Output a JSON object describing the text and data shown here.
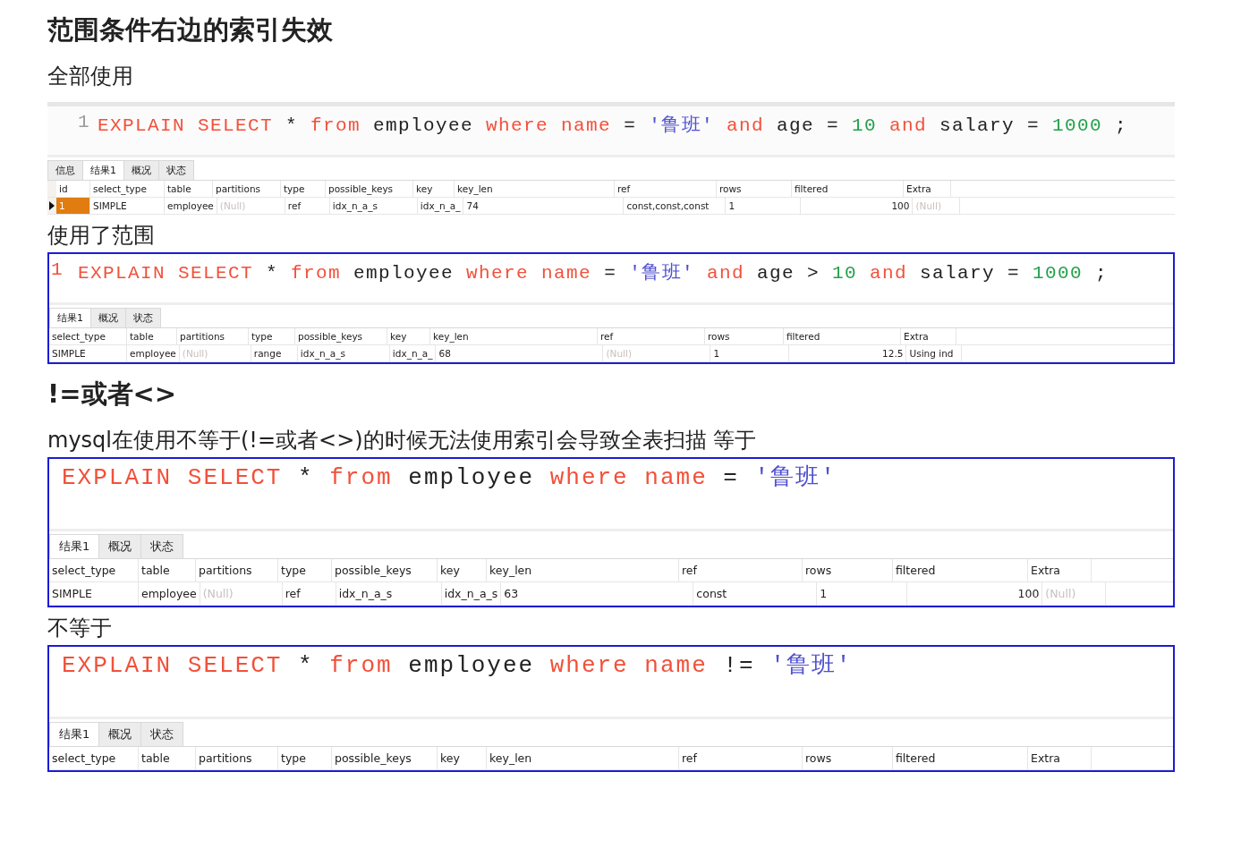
{
  "blocks": [
    {
      "kind": "heading",
      "text": "范围条件右边的索引失效"
    },
    {
      "kind": "paragraph",
      "text": "全部使用"
    },
    {
      "kind": "query",
      "boxed": false,
      "line_number": "1",
      "code": [
        {
          "kind": "keyword",
          "text": "EXPLAIN"
        },
        {
          "kind": "keyword",
          "text": "SELECT"
        },
        {
          "kind": "plain",
          "text": "*"
        },
        {
          "kind": "keyword",
          "text": "from"
        },
        {
          "kind": "plain",
          "text": "employee"
        },
        {
          "kind": "keyword",
          "text": "where"
        },
        {
          "kind": "keyword",
          "text": "name"
        },
        {
          "kind": "plain",
          "text": "="
        },
        {
          "kind": "string",
          "text": "'鲁班'"
        },
        {
          "kind": "keyword",
          "text": "and"
        },
        {
          "kind": "plain",
          "text": "age"
        },
        {
          "kind": "plain",
          "text": "="
        },
        {
          "kind": "number",
          "text": "10"
        },
        {
          "kind": "keyword",
          "text": "and"
        },
        {
          "kind": "plain",
          "text": "salary"
        },
        {
          "kind": "plain",
          "text": "="
        },
        {
          "kind": "number",
          "text": "1000"
        },
        {
          "kind": "plain",
          "text": ";"
        }
      ],
      "tabs": [
        {
          "label": "信息",
          "selected": false
        },
        {
          "label": "结果1",
          "selected": true
        },
        {
          "label": "概况",
          "selected": false
        },
        {
          "label": "状态",
          "selected": false
        }
      ],
      "columns": [
        "id",
        "select_type",
        "table",
        "partitions",
        "type",
        "possible_keys",
        "key",
        "key_len",
        "ref",
        "rows",
        "filtered",
        "Extra"
      ],
      "rows": [
        {
          "selected": true,
          "cells": [
            {
              "text": "1",
              "muted": false
            },
            {
              "text": "SIMPLE",
              "muted": false
            },
            {
              "text": "employee",
              "muted": false
            },
            {
              "text": "(Null)",
              "muted": true
            },
            {
              "text": "ref",
              "muted": false
            },
            {
              "text": "idx_n_a_s",
              "muted": false
            },
            {
              "text": "idx_n_a_",
              "muted": false
            },
            {
              "text": "74",
              "muted": false
            },
            {
              "text": "const,const,const",
              "muted": false
            },
            {
              "text": "1",
              "muted": false
            },
            {
              "text": "100",
              "muted": false
            },
            {
              "text": "(Null)",
              "muted": true
            }
          ]
        }
      ]
    },
    {
      "kind": "paragraph",
      "text": "使用了范围"
    },
    {
      "kind": "query",
      "boxed": true,
      "line_number": "1",
      "code": [
        {
          "kind": "keyword",
          "text": "EXPLAIN"
        },
        {
          "kind": "keyword",
          "text": "SELECT"
        },
        {
          "kind": "plain",
          "text": "*"
        },
        {
          "kind": "keyword",
          "text": "from"
        },
        {
          "kind": "plain",
          "text": "employee"
        },
        {
          "kind": "keyword",
          "text": "where"
        },
        {
          "kind": "keyword",
          "text": "name"
        },
        {
          "kind": "plain",
          "text": "="
        },
        {
          "kind": "string",
          "text": "'鲁班'"
        },
        {
          "kind": "keyword",
          "text": "and"
        },
        {
          "kind": "plain",
          "text": "age"
        },
        {
          "kind": "plain",
          "text": ">"
        },
        {
          "kind": "number",
          "text": "10"
        },
        {
          "kind": "keyword",
          "text": "and"
        },
        {
          "kind": "plain",
          "text": "salary"
        },
        {
          "kind": "plain",
          "text": "="
        },
        {
          "kind": "number",
          "text": "1000"
        },
        {
          "kind": "plain",
          "text": ";"
        }
      ],
      "tabs": [
        {
          "label": "结果1",
          "selected": true
        },
        {
          "label": "概况",
          "selected": false
        },
        {
          "label": "状态",
          "selected": false
        }
      ],
      "columns": [
        "select_type",
        "table",
        "partitions",
        "type",
        "possible_keys",
        "key",
        "key_len",
        "ref",
        "rows",
        "filtered",
        "Extra"
      ],
      "rows": [
        {
          "cells": [
            {
              "text": "SIMPLE",
              "muted": false
            },
            {
              "text": "employee",
              "muted": false
            },
            {
              "text": "(Null)",
              "muted": true
            },
            {
              "text": "range",
              "muted": false
            },
            {
              "text": "idx_n_a_s",
              "muted": false
            },
            {
              "text": "idx_n_a_",
              "muted": false
            },
            {
              "text": "68",
              "muted": false
            },
            {
              "text": "(Null)",
              "muted": true
            },
            {
              "text": "1",
              "muted": false
            },
            {
              "text": "12.5",
              "muted": false
            },
            {
              "text": "Using ind",
              "muted": false
            }
          ]
        }
      ]
    },
    {
      "kind": "heading",
      "text": "!=或者<>"
    },
    {
      "kind": "paragraph",
      "text": "mysql在使用不等于(!=或者<>)的时候无法使用索引会导致全表扫描 等于"
    },
    {
      "kind": "query",
      "boxed": true,
      "code": [
        {
          "kind": "keyword",
          "text": "EXPLAIN"
        },
        {
          "kind": "keyword",
          "text": "SELECT"
        },
        {
          "kind": "plain",
          "text": "*"
        },
        {
          "kind": "keyword",
          "text": "from"
        },
        {
          "kind": "plain",
          "text": "employee"
        },
        {
          "kind": "keyword",
          "text": "where"
        },
        {
          "kind": "keyword",
          "text": "name"
        },
        {
          "kind": "plain",
          "text": "="
        },
        {
          "kind": "string",
          "text": "'鲁班'"
        }
      ],
      "tabs": [
        {
          "label": "结果1",
          "selected": true
        },
        {
          "label": "概况",
          "selected": false
        },
        {
          "label": "状态",
          "selected": false
        }
      ],
      "columns": [
        "select_type",
        "table",
        "partitions",
        "type",
        "possible_keys",
        "key",
        "key_len",
        "ref",
        "rows",
        "filtered",
        "Extra"
      ],
      "rows": [
        {
          "cells": [
            {
              "text": "SIMPLE",
              "muted": false
            },
            {
              "text": "employee",
              "muted": false
            },
            {
              "text": "(Null)",
              "muted": true
            },
            {
              "text": "ref",
              "muted": false
            },
            {
              "text": "idx_n_a_s",
              "muted": false
            },
            {
              "text": "idx_n_a_s",
              "muted": false
            },
            {
              "text": "63",
              "muted": false
            },
            {
              "text": "const",
              "muted": false
            },
            {
              "text": "1",
              "muted": false
            },
            {
              "text": "100",
              "muted": false
            },
            {
              "text": "(Null)",
              "muted": true
            }
          ]
        }
      ]
    },
    {
      "kind": "paragraph",
      "text": "不等于"
    },
    {
      "kind": "query",
      "boxed": true,
      "code": [
        {
          "kind": "keyword",
          "text": "EXPLAIN"
        },
        {
          "kind": "keyword",
          "text": "SELECT"
        },
        {
          "kind": "plain",
          "text": "*"
        },
        {
          "kind": "keyword",
          "text": "from"
        },
        {
          "kind": "plain",
          "text": "employee"
        },
        {
          "kind": "keyword",
          "text": "where"
        },
        {
          "kind": "keyword",
          "text": "name"
        },
        {
          "kind": "plain",
          "text": "!="
        },
        {
          "kind": "string",
          "text": "'鲁班'"
        }
      ],
      "tabs": [
        {
          "label": "结果1",
          "selected": true
        },
        {
          "label": "概况",
          "selected": false
        },
        {
          "label": "状态",
          "selected": false
        }
      ],
      "columns": [
        "select_type",
        "table",
        "partitions",
        "type",
        "possible_keys",
        "key",
        "key_len",
        "ref",
        "rows",
        "filtered",
        "Extra"
      ]
    }
  ]
}
